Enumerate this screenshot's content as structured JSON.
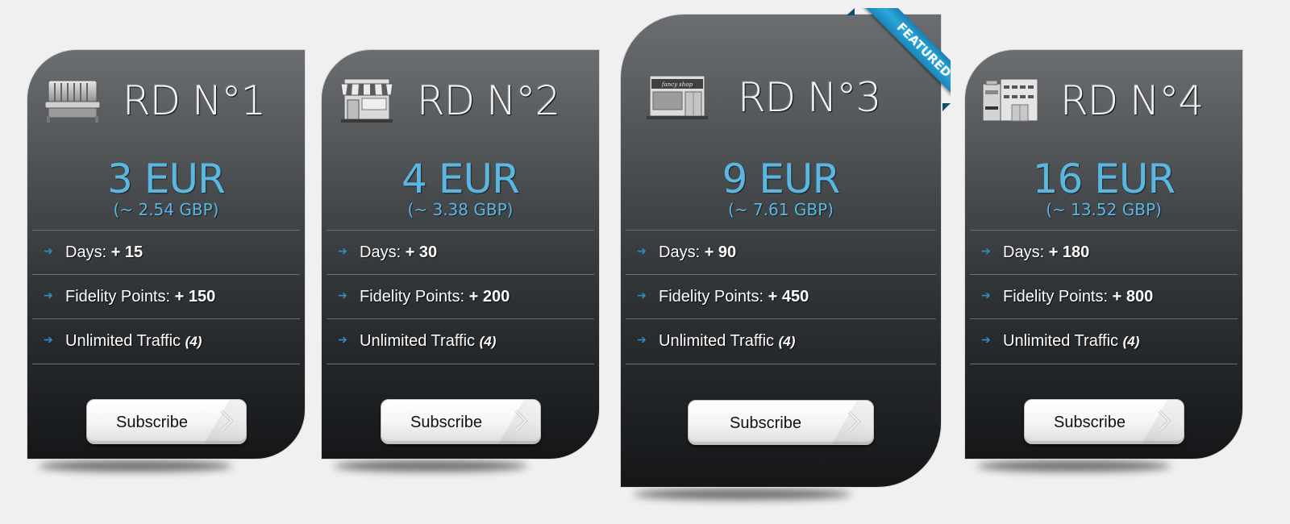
{
  "plans": [
    {
      "title": "RD N°1",
      "icon": "bench-icon",
      "price": "3 EUR",
      "price_alt": "(~ 2.54 GBP)",
      "features": [
        {
          "label": "Days:",
          "value": "+ 15"
        },
        {
          "label": "Fidelity Points:",
          "value": "+ 150"
        },
        {
          "label": "Unlimited Traffic",
          "note": "(4)"
        }
      ],
      "button": "Subscribe",
      "featured": false
    },
    {
      "title": "RD N°2",
      "icon": "market-stall-icon",
      "price": "4 EUR",
      "price_alt": "(~ 3.38 GBP)",
      "features": [
        {
          "label": "Days:",
          "value": "+ 30"
        },
        {
          "label": "Fidelity Points:",
          "value": "+ 200"
        },
        {
          "label": "Unlimited Traffic",
          "note": "(4)"
        }
      ],
      "button": "Subscribe",
      "featured": false
    },
    {
      "title": "RD N°3",
      "icon": "shop-icon",
      "icon_sign": "fancy shop",
      "price": "9 EUR",
      "price_alt": "(~ 7.61 GBP)",
      "features": [
        {
          "label": "Days:",
          "value": "+ 90"
        },
        {
          "label": "Fidelity Points:",
          "value": "+ 450"
        },
        {
          "label": "Unlimited Traffic",
          "note": "(4)"
        }
      ],
      "button": "Subscribe",
      "featured": true,
      "ribbon": "FEATURED"
    },
    {
      "title": "RD N°4",
      "icon": "office-building-icon",
      "price": "16 EUR",
      "price_alt": "(~ 13.52 GBP)",
      "features": [
        {
          "label": "Days:",
          "value": "+ 180"
        },
        {
          "label": "Fidelity Points:",
          "value": "+ 800"
        },
        {
          "label": "Unlimited Traffic",
          "note": "(4)"
        }
      ],
      "button": "Subscribe",
      "featured": false
    }
  ],
  "colors": {
    "price": "#5ab7e2",
    "arrow": "#2f8fbf",
    "ribbon": "#2aa8d8",
    "card_top": "#6b6e71",
    "card_bottom": "#141618",
    "background": "#f0f0f0"
  }
}
